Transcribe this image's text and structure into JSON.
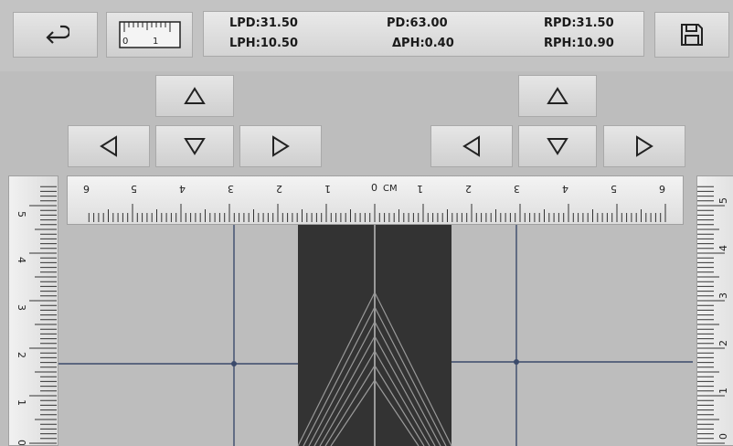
{
  "readout": {
    "lpd": "LPD:31.50",
    "pd": "PD:63.00",
    "rpd": "RPD:31.50",
    "lph": "LPH:10.50",
    "dph": "ΔPH:0.40",
    "rph": "RPH:10.90"
  },
  "icons": {
    "back": "return-arrow-icon",
    "ruler": "ruler-icon",
    "save": "floppy-disk-icon",
    "up": "triangle-up-icon",
    "down": "triangle-down-icon",
    "left": "triangle-left-icon",
    "right": "triangle-right-icon"
  },
  "ruler_icon_labels": [
    "0",
    "1"
  ],
  "top_ruler": {
    "unit": "CM",
    "zero": "0",
    "left_labels": [
      "6",
      "5",
      "4",
      "3",
      "2",
      "1"
    ],
    "right_labels": [
      "1",
      "2",
      "3",
      "4",
      "5",
      "6"
    ]
  },
  "side_ruler": {
    "labels": [
      "5",
      "4",
      "3",
      "2",
      "1",
      "0"
    ]
  },
  "colors": {
    "background": "#bdbdbd",
    "button": "#dcdcdc",
    "guide_line": "#3b4a6b",
    "frame_dark": "#333333",
    "bevel_lines": "#9a9a9a"
  }
}
